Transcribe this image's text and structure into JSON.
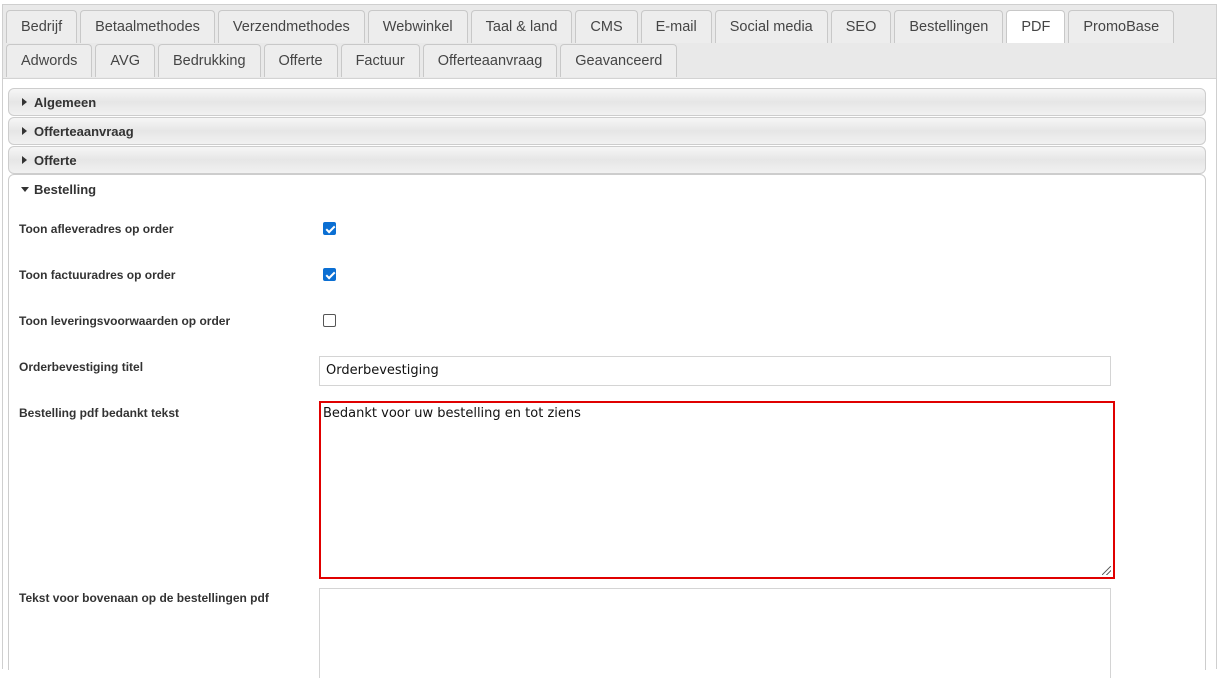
{
  "tabs_row1": [
    {
      "label": "Bedrijf"
    },
    {
      "label": "Betaalmethodes"
    },
    {
      "label": "Verzendmethodes"
    },
    {
      "label": "Webwinkel"
    },
    {
      "label": "Taal & land"
    },
    {
      "label": "CMS"
    },
    {
      "label": "E-mail"
    },
    {
      "label": "Social media"
    },
    {
      "label": "SEO"
    },
    {
      "label": "Bestellingen"
    },
    {
      "label": "PDF",
      "active": true
    },
    {
      "label": "PromoBase"
    }
  ],
  "tabs_row2": [
    {
      "label": "Adwords"
    },
    {
      "label": "AVG"
    },
    {
      "label": "Bedrukking"
    },
    {
      "label": "Offerte"
    },
    {
      "label": "Factuur"
    },
    {
      "label": "Offerteaanvraag"
    },
    {
      "label": "Geavanceerd"
    }
  ],
  "accordion": [
    {
      "title": "Algemeen",
      "state": "collapsed"
    },
    {
      "title": "Offerteaanvraag",
      "state": "collapsed"
    },
    {
      "title": "Offerte",
      "state": "collapsed"
    },
    {
      "title": "Bestelling",
      "state": "expanded"
    }
  ],
  "form": {
    "show_delivery_address": {
      "label": "Toon afleveradres op order",
      "checked": true
    },
    "show_invoice_address": {
      "label": "Toon factuuradres op order",
      "checked": true
    },
    "show_terms": {
      "label": "Toon leveringsvoorwaarden op order",
      "checked": false
    },
    "order_confirmation_title": {
      "label": "Orderbevestiging titel",
      "value": "Orderbevestiging"
    },
    "thank_you_text": {
      "label": "Bestelling pdf bedankt tekst",
      "value": "Bedankt voor uw bestelling en tot ziens"
    },
    "top_text": {
      "label": "Tekst voor bovenaan op de bestellingen pdf",
      "value": ""
    }
  },
  "colors": {
    "highlight_border": "#e00000",
    "checkbox_checked": "#0b6fd3",
    "tab_bar_background": "#e9e9e9"
  },
  "icons": {
    "collapsed": "caret-right-icon",
    "expanded": "caret-down-icon",
    "checkbox": "checkbox-icon"
  }
}
